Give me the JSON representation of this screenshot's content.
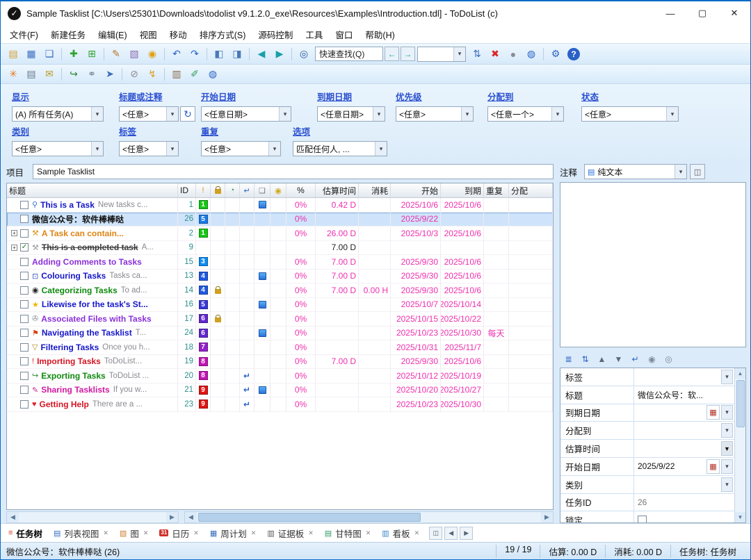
{
  "window": {
    "title": "Sample Tasklist [C:\\Users\\25301\\Downloads\\todolist v9.1.2.0_exe\\Resources\\Examples\\Introduction.tdl] - ToDoList (c)",
    "logo_check": "✓",
    "minimize": "—",
    "maximize": "▢",
    "close": "✕"
  },
  "icons": {
    "dropdown": "▾",
    "check": "✓",
    "close": "✕",
    "scroll_left": "◀",
    "scroll_right": "▶",
    "scroll_up": "▲",
    "scroll_down": "▼",
    "refresh": "↻",
    "expand": "+",
    "recurrence": "↵"
  },
  "menu": [
    "文件(F)",
    "新建任务",
    "编辑(E)",
    "视图",
    "移动",
    "排序方式(S)",
    "源码控制",
    "工具",
    "窗口",
    "帮助(H)"
  ],
  "toolbar1_icons_left": [
    {
      "name": "open-tasklist-icon",
      "glyph": "▤",
      "color": "#d89c2e"
    },
    {
      "name": "save-tasklist-icon",
      "glyph": "▦",
      "color": "#3a6cc0"
    },
    {
      "name": "save-all-icon",
      "glyph": "❏",
      "color": "#3a6cc0"
    },
    {
      "sep": true
    },
    {
      "name": "new-task-icon",
      "glyph": "✚",
      "color": "#2ca42c"
    },
    {
      "name": "new-subtask-icon",
      "glyph": "⊞",
      "color": "#2ca42c"
    },
    {
      "sep": true
    },
    {
      "name": "edit-task-icon",
      "glyph": "✎",
      "color": "#b8762a"
    },
    {
      "name": "task-icon-picker-icon",
      "glyph": "▧",
      "color": "#8a6ab0"
    },
    {
      "name": "reminder-icon",
      "glyph": "◉",
      "color": "#e0a010"
    },
    {
      "sep": true
    },
    {
      "name": "undo-icon",
      "glyph": "↶",
      "color": "#2a62c8"
    },
    {
      "name": "redo-icon",
      "glyph": "↷",
      "color": "#2a62c8"
    },
    {
      "sep": true
    },
    {
      "name": "maximize-tasklist-icon",
      "glyph": "◧",
      "color": "#4a7ab8"
    },
    {
      "name": "maximize-comments-icon",
      "glyph": "◨",
      "color": "#4a7ab8"
    },
    {
      "sep": true
    },
    {
      "name": "nav-back-icon",
      "glyph": "◀",
      "color": "#18a0a8"
    },
    {
      "name": "nav-forward-icon",
      "glyph": "▶",
      "color": "#18a0a8"
    },
    {
      "sep": true
    },
    {
      "name": "find-tasks-icon",
      "glyph": "◎",
      "color": "#2a5a9a"
    }
  ],
  "toolbar1": {
    "quickfind": "快速查找(Q)"
  },
  "toolbar1_icons_right": [
    {
      "name": "sort-icon",
      "glyph": "⇅",
      "color": "#3a6cc0"
    },
    {
      "name": "delete-task-icon",
      "glyph": "✖",
      "color": "#d82828"
    },
    {
      "name": "encrypt-icon",
      "glyph": "●",
      "color": "#8a8a92"
    },
    {
      "name": "weblink-icon",
      "glyph": "◍",
      "color": "#2a62c8"
    },
    {
      "sep": true
    },
    {
      "name": "preferences-icon",
      "glyph": "⚙",
      "color": "#2a62c8"
    },
    {
      "name": "help-icon",
      "glyph": "?",
      "color": "#ffffff",
      "cls": "round-help"
    }
  ],
  "toolbar2_icons": [
    {
      "name": "new-features-icon",
      "glyph": "✳",
      "color": "#e87820"
    },
    {
      "name": "print-icon",
      "glyph": "▤",
      "color": "#66778a"
    },
    {
      "name": "send-email-icon",
      "glyph": "✉",
      "color": "#b89a20"
    },
    {
      "sep": true
    },
    {
      "name": "export-tasklist-icon",
      "glyph": "↪",
      "color": "#2a8a3a"
    },
    {
      "name": "link-tasklist-icon",
      "glyph": "⚭",
      "color": "#7a8a9a"
    },
    {
      "name": "send-tasklist-icon",
      "glyph": "➤",
      "color": "#3a6cc0"
    },
    {
      "sep": true
    },
    {
      "name": "work-offline-icon",
      "glyph": "⊘",
      "color": "#8a8a92"
    },
    {
      "name": "shortcuts-icon",
      "glyph": "↯",
      "color": "#d8a020"
    },
    {
      "sep": true
    },
    {
      "name": "reference-icon",
      "glyph": "▥",
      "color": "#8a6a4a"
    },
    {
      "name": "cleanup-icon",
      "glyph": "✐",
      "color": "#2f9e5f"
    },
    {
      "name": "browser-icon",
      "glyph": "◍",
      "color": "#2a62c8"
    }
  ],
  "filters": {
    "row1": [
      {
        "label": "显示",
        "value": "(A) 所有任务(A)"
      },
      {
        "label": "标题或注释",
        "value": "<任意>",
        "refresh": true
      },
      {
        "label": "开始日期",
        "value": "<任意日期>"
      },
      {
        "label": "到期日期",
        "value": "<任意日期>"
      },
      {
        "label": "优先级",
        "value": "<任意>"
      },
      {
        "label": "分配到",
        "value": "<任意一个>"
      },
      {
        "label": "状态",
        "value": "<任意>"
      }
    ],
    "row2": [
      {
        "label": "类别",
        "value": "<任意>"
      },
      {
        "label": "标签",
        "value": "<任意>"
      },
      {
        "label": "重复",
        "value": "<任意>"
      },
      {
        "label": "选项",
        "value": "匹配任何人, ..."
      }
    ]
  },
  "project": {
    "label": "项目",
    "value": "Sample Tasklist"
  },
  "comments": {
    "label": "注释",
    "format": "纯文本"
  },
  "tasktable": {
    "headers": {
      "title": "标题",
      "id": "ID",
      "percent": "%",
      "est": "估算时间",
      "spent": "消耗",
      "start": "开始",
      "due": "到期",
      "recur": "重复",
      "alloc": "分配"
    },
    "rows": [
      {
        "id": "1",
        "priority": "1",
        "priority_color": "#17c617",
        "icon_name": "search-icon",
        "icon_glyph": "⚲",
        "icon_color": "#3a76c8",
        "title": "This is a Task",
        "subtitle": "New tasks c...",
        "title_color": "#1616c8",
        "file": true,
        "percent": "0%",
        "est": "0.42 D",
        "start": "2025/10/6",
        "due": "2025/10/6"
      },
      {
        "id": "26",
        "priority": "5",
        "priority_color": "#1a7ae8",
        "selected": true,
        "title": "微信公众号：软件棒棒哒",
        "title_color": "#101010",
        "percent": "0%",
        "start": "2025/9/22"
      },
      {
        "id": "2",
        "priority": "1",
        "priority_color": "#17c617",
        "expand": true,
        "icon_name": "tools-icon",
        "icon_glyph": "⚒",
        "icon_color": "#d89a20",
        "title": "A Task can contain...",
        "title_color": "#e08414",
        "percent": "0%",
        "est": "26.00 D",
        "start": "2025/10/3",
        "due": "2025/10/6"
      },
      {
        "id": "9",
        "expand": true,
        "checked": true,
        "icon_name": "tools-icon",
        "icon_glyph": "⚒",
        "icon_color": "#9a9aa0",
        "title": "This is a completed task",
        "subtitle": "A...",
        "title_color": "#3a3a3a",
        "strike": true,
        "est": "7.00 D",
        "est_dark": true
      },
      {
        "id": "15",
        "priority": "3",
        "priority_color": "#0f8cf0",
        "title": "Adding Comments to Tasks",
        "title_color": "#8a30d8",
        "percent": "0%",
        "est": "7.00 D",
        "start": "2025/9/30",
        "due": "2025/10/6"
      },
      {
        "id": "13",
        "priority": "4",
        "priority_color": "#1f5ae0",
        "icon_name": "monitor-icon",
        "icon_glyph": "⊡",
        "icon_color": "#3a5ac0",
        "title": "Colouring Tasks",
        "subtitle": "Tasks ca...",
        "title_color": "#1616c8",
        "file": true,
        "percent": "0%",
        "est": "7.00 D",
        "start": "2025/9/30",
        "due": "2025/10/6"
      },
      {
        "id": "14",
        "priority": "4",
        "priority_color": "#1f5ae0",
        "lock": true,
        "icon_name": "soccer-ball-icon",
        "icon_glyph": "◉",
        "icon_color": "#222222",
        "title": "Categorizing Tasks",
        "subtitle": "To ad...",
        "title_color": "#0f8a0f",
        "percent": "0%",
        "est": "7.00 D",
        "spent": "0.00 H",
        "start": "2025/9/30",
        "due": "2025/10/6"
      },
      {
        "id": "16",
        "priority": "5",
        "priority_color": "#3838d8",
        "icon_name": "star-icon",
        "icon_glyph": "★",
        "icon_color": "#f0b400",
        "title": "Likewise for the task's St...",
        "title_color": "#1616c8",
        "file": true,
        "percent": "0%",
        "start": "2025/10/7",
        "due": "2025/10/14"
      },
      {
        "id": "17",
        "priority": "6",
        "priority_color": "#6428d0",
        "lock": true,
        "icon_name": "paperclip-icon",
        "icon_glyph": "✇",
        "icon_color": "#8a8a92",
        "title": "Associated Files with Tasks",
        "title_color": "#8a30d8",
        "percent": "0%",
        "start": "2025/10/15",
        "due": "2025/10/22"
      },
      {
        "id": "24",
        "priority": "6",
        "priority_color": "#6428d0",
        "icon_name": "flag-icon",
        "icon_glyph": "⚑",
        "icon_color": "#d84010",
        "title": "Navigating the Tasklist",
        "subtitle": "T...",
        "title_color": "#1616c8",
        "file": true,
        "percent": "0%",
        "start": "2025/10/23",
        "due": "2025/10/30",
        "recur": "每天"
      },
      {
        "id": "18",
        "priority": "7",
        "priority_color": "#9420c8",
        "icon_name": "filter-icon",
        "icon_glyph": "▽",
        "icon_color": "#b08820",
        "title": "Filtering Tasks",
        "subtitle": "Once you h...",
        "title_color": "#1616c8",
        "percent": "0%",
        "start": "2025/10/31",
        "due": "2025/11/7"
      },
      {
        "id": "19",
        "priority": "8",
        "priority_color": "#c214b4",
        "icon_name": "exclamation-icon",
        "icon_glyph": "!",
        "icon_color": "#e02020",
        "title": "Importing Tasks",
        "subtitle": "ToDoList...",
        "title_color": "#d41624",
        "percent": "0%",
        "est": "7.00 D",
        "start": "2025/9/30",
        "due": "2025/10/6"
      },
      {
        "id": "20",
        "priority": "8",
        "priority_color": "#c214b4",
        "recur_icon": true,
        "icon_name": "export-icon",
        "icon_glyph": "↪",
        "icon_color": "#2a8a3a",
        "title": "Exporting Tasks",
        "subtitle": "ToDoList ...",
        "title_color": "#0f8a0f",
        "percent": "0%",
        "start": "2025/10/12",
        "due": "2025/10/19"
      },
      {
        "id": "21",
        "priority": "9",
        "priority_color": "#e01414",
        "recur_icon": true,
        "icon_name": "pencil-icon",
        "icon_glyph": "✎",
        "icon_color": "#c82890",
        "title": "Sharing Tasklists",
        "subtitle": "If you w...",
        "title_color": "#d018a0",
        "file": true,
        "percent": "0%",
        "start": "2025/10/20",
        "due": "2025/10/27"
      },
      {
        "id": "23",
        "priority": "9",
        "priority_color": "#e01414",
        "recur_icon": true,
        "icon_name": "heart-icon",
        "icon_glyph": "♥",
        "icon_color": "#e02030",
        "title": "Getting Help",
        "subtitle": "There are a ...",
        "title_color": "#d41624",
        "percent": "0%",
        "start": "2025/10/23",
        "due": "2025/10/30"
      }
    ]
  },
  "attr_toolbar_icons": [
    {
      "name": "attr-groups-icon",
      "glyph": "≣",
      "color": "#2a62c8"
    },
    {
      "name": "attr-sort-icon",
      "glyph": "⇅",
      "color": "#2a62c8"
    },
    {
      "name": "attr-move-up-icon",
      "glyph": "▲",
      "color": "#5a6a7a"
    },
    {
      "name": "attr-move-down-icon",
      "glyph": "▼",
      "color": "#5a6a7a"
    },
    {
      "name": "attr-wrap-icon",
      "glyph": "↵",
      "color": "#2a62c8"
    },
    {
      "name": "add-dependency-icon",
      "glyph": "◉",
      "color": "#7a8a9a"
    },
    {
      "name": "remove-dependency-icon",
      "glyph": "◎",
      "color": "#7a8a9a"
    }
  ],
  "attributes": {
    "rows": [
      {
        "label": "标签",
        "type": "combo",
        "value": ""
      },
      {
        "label": "标题",
        "type": "text",
        "value": "微信公众号：软..."
      },
      {
        "label": "到期日期",
        "type": "date",
        "value": ""
      },
      {
        "label": "分配到",
        "type": "combo",
        "value": ""
      },
      {
        "label": "估算时间",
        "type": "combo-dark",
        "value": ""
      },
      {
        "label": "开始日期",
        "type": "date",
        "value": "2025/9/22"
      },
      {
        "label": "类别",
        "type": "combo",
        "value": ""
      },
      {
        "label": "任务ID",
        "type": "text-muted",
        "value": "26"
      },
      {
        "label": "锁定",
        "type": "checkbox",
        "checked": false
      }
    ]
  },
  "tabs": [
    {
      "name": "tab-task-tree",
      "label": "任务树",
      "active": true,
      "icon": {
        "name": "task-tree-icon",
        "glyph": "≡",
        "color": "#d04020"
      }
    },
    {
      "name": "tab-list-view",
      "label": "列表视图",
      "closable": true,
      "icon": {
        "name": "list-view-icon",
        "glyph": "▤",
        "color": "#3a6cc0"
      }
    },
    {
      "name": "tab-diagram",
      "label": "图",
      "closable": true,
      "icon": {
        "name": "diagram-icon",
        "glyph": "▧",
        "color": "#d08030"
      }
    },
    {
      "name": "tab-calendar",
      "label": "日历",
      "closable": true,
      "icon": {
        "name": "calendar-icon",
        "glyph": "31",
        "color": "#ffffff",
        "bg": "#d03028"
      }
    },
    {
      "name": "tab-week-planner",
      "label": "周计划",
      "closable": true,
      "icon": {
        "name": "week-planner-icon",
        "glyph": "▦",
        "color": "#3a6cc0"
      }
    },
    {
      "name": "tab-evidence-board",
      "label": "证据板",
      "closable": true,
      "icon": {
        "name": "evidence-board-icon",
        "glyph": "▥",
        "color": "#555555"
      }
    },
    {
      "name": "tab-gantt",
      "label": "甘特图",
      "closable": true,
      "icon": {
        "name": "gantt-icon",
        "glyph": "▤",
        "color": "#2f9e5f"
      }
    },
    {
      "name": "tab-kanban",
      "label": "看板",
      "closable": true,
      "icon": {
        "name": "kanban-icon",
        "glyph": "▥",
        "color": "#3a86d0"
      }
    }
  ],
  "tabbar_extra": {
    "view_icon": "◫"
  },
  "statusbar": {
    "selection": "微信公众号：软件棒棒哒  (26)",
    "segments": [
      "19 / 19",
      "估算: 0.00 D",
      "消耗: 0.00 D",
      "任务树: 任务树"
    ]
  }
}
